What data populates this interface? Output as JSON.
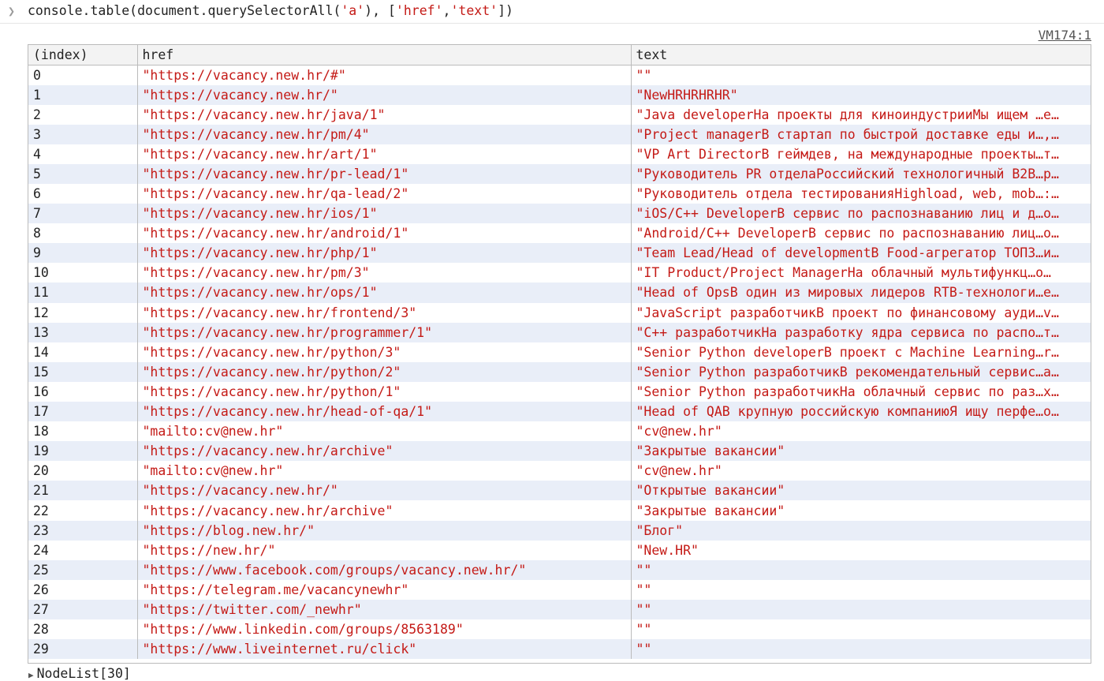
{
  "command": {
    "prefix": "console.table(document.querySelectorAll(",
    "arg1": "'a'",
    "mid": "), [",
    "arg2": "'href'",
    "comma": ",",
    "arg3": "'text'",
    "suffix": "])"
  },
  "source_link": "VM174:1",
  "table": {
    "headers": [
      "(index)",
      "href",
      "text"
    ],
    "rows": [
      {
        "index": "0",
        "href": "\"https://vacancy.new.hr/#\"",
        "text": "\"\""
      },
      {
        "index": "1",
        "href": "\"https://vacancy.new.hr/\"",
        "text": "\"NewHRHRHRHR\""
      },
      {
        "index": "2",
        "href": "\"https://vacancy.new.hr/java/1\"",
        "text": "\"Java developerНа проекты для киноиндустрииМы ищем …е…"
      },
      {
        "index": "3",
        "href": "\"https://vacancy.new.hr/pm/4\"",
        "text": "\"Project managerВ стартап по быстрой доставке еды и…,…"
      },
      {
        "index": "4",
        "href": "\"https://vacancy.new.hr/art/1\"",
        "text": "\"VP Art DirectorВ геймдев, на международные проекты…т…"
      },
      {
        "index": "5",
        "href": "\"https://vacancy.new.hr/pr-lead/1\"",
        "text": "\"Руководитель PR отделаРоссийский технологичный B2B…р…"
      },
      {
        "index": "6",
        "href": "\"https://vacancy.new.hr/qa-lead/2\"",
        "text": "\"Руководитель отдела тестированияHighload, web, mob…:…"
      },
      {
        "index": "7",
        "href": "\"https://vacancy.new.hr/ios/1\"",
        "text": "\"iOS/C++ DeveloperВ сервис по распознаванию лиц и д…о…"
      },
      {
        "index": "8",
        "href": "\"https://vacancy.new.hr/android/1\"",
        "text": "\"Android/C++ DeveloperВ сервис по распознаванию лиц…о…"
      },
      {
        "index": "9",
        "href": "\"https://vacancy.new.hr/php/1\"",
        "text": "\"Team Lead/Head of developmentВ Food-агрегатор ТОП3…и…"
      },
      {
        "index": "10",
        "href": "\"https://vacancy.new.hr/pm/3\"",
        "text": "\"IT Product/Project ManagerНа облачный мультифункц…о…"
      },
      {
        "index": "11",
        "href": "\"https://vacancy.new.hr/ops/1\"",
        "text": "\"Head of OpsВ один из мировых лидеров RTB-технологи…е…"
      },
      {
        "index": "12",
        "href": "\"https://vacancy.new.hr/frontend/3\"",
        "text": "\"JavaScript разработчикВ проект по финансовому ауди…v…"
      },
      {
        "index": "13",
        "href": "\"https://vacancy.new.hr/programmer/1\"",
        "text": "\"C++ разработчикНа разработку ядра сервиса по распо…т…"
      },
      {
        "index": "14",
        "href": "\"https://vacancy.new.hr/python/3\"",
        "text": "\"Senior Python developerВ проект с Machine Learning…r…"
      },
      {
        "index": "15",
        "href": "\"https://vacancy.new.hr/python/2\"",
        "text": "\"Senior Python разработчикВ рекомендательный сервис…а…"
      },
      {
        "index": "16",
        "href": "\"https://vacancy.new.hr/python/1\"",
        "text": "\"Senior Python разработчикНа облачный сервис по раз…х…"
      },
      {
        "index": "17",
        "href": "\"https://vacancy.new.hr/head-of-qa/1\"",
        "text": "\"Head of QAВ крупную российскую компаниюЯ ищу перфе…о…"
      },
      {
        "index": "18",
        "href": "\"mailto:cv@new.hr\"",
        "text": "\"cv@new.hr\""
      },
      {
        "index": "19",
        "href": "\"https://vacancy.new.hr/archive\"",
        "text": "\"Закрытые вакансии\""
      },
      {
        "index": "20",
        "href": "\"mailto:cv@new.hr\"",
        "text": "\"cv@new.hr\""
      },
      {
        "index": "21",
        "href": "\"https://vacancy.new.hr/\"",
        "text": "\"Открытые вакансии\""
      },
      {
        "index": "22",
        "href": "\"https://vacancy.new.hr/archive\"",
        "text": "\"Закрытые вакансии\""
      },
      {
        "index": "23",
        "href": "\"https://blog.new.hr/\"",
        "text": "\"Блог\""
      },
      {
        "index": "24",
        "href": "\"https://new.hr/\"",
        "text": "\"New.HR\""
      },
      {
        "index": "25",
        "href": "\"https://www.facebook.com/groups/vacancy.new.hr/\"",
        "text": "\"\""
      },
      {
        "index": "26",
        "href": "\"https://telegram.me/vacancynewhr\"",
        "text": "\"\""
      },
      {
        "index": "27",
        "href": "\"https://twitter.com/_newhr\"",
        "text": "\"\""
      },
      {
        "index": "28",
        "href": "\"https://www.linkedin.com/groups/8563189\"",
        "text": "\"\""
      },
      {
        "index": "29",
        "href": "\"https://www.liveinternet.ru/click\"",
        "text": "\"\""
      }
    ]
  },
  "nodelist_label": "NodeList[30]",
  "colors": {
    "string": "#c41a16",
    "stripe": "#e9eef8",
    "border": "#bbbbbb"
  }
}
